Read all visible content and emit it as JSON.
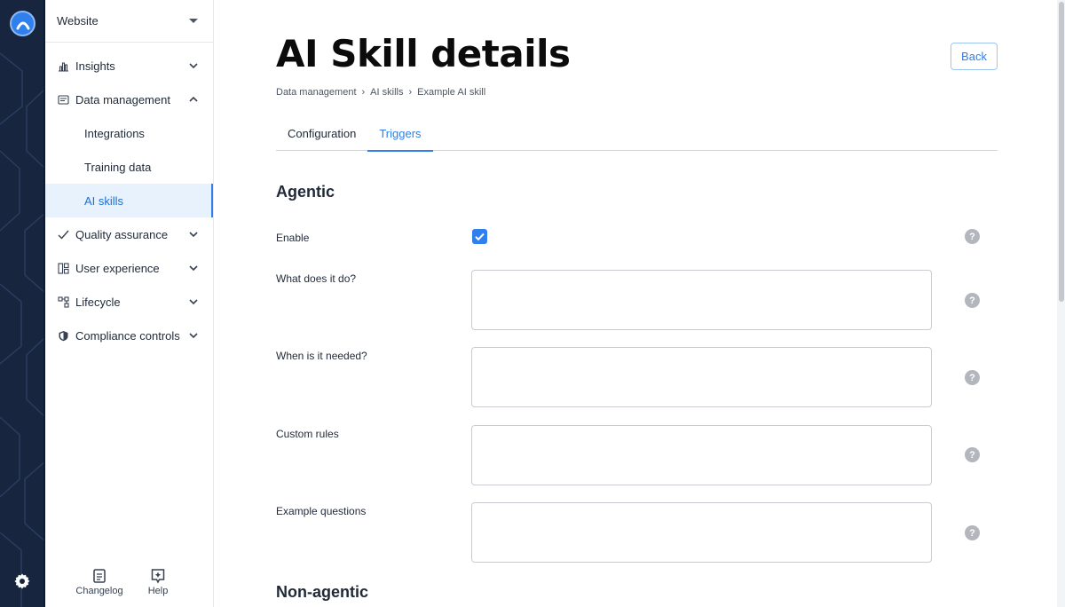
{
  "sidebar": {
    "workspace": "Website",
    "items": [
      {
        "label": "Insights",
        "icon": "bar-chart-icon",
        "expanded": false
      },
      {
        "label": "Data management",
        "icon": "database-icon",
        "expanded": true,
        "children": [
          {
            "label": "Integrations",
            "active": false
          },
          {
            "label": "Training data",
            "active": false
          },
          {
            "label": "AI skills",
            "active": true
          }
        ]
      },
      {
        "label": "Quality assurance",
        "icon": "check-icon",
        "expanded": false
      },
      {
        "label": "User experience",
        "icon": "layout-icon",
        "expanded": false
      },
      {
        "label": "Lifecycle",
        "icon": "flow-icon",
        "expanded": false
      },
      {
        "label": "Compliance controls",
        "icon": "shield-icon",
        "expanded": false
      }
    ],
    "footer": {
      "changelog": "Changelog",
      "help": "Help"
    }
  },
  "header": {
    "title": "AI Skill details",
    "back": "Back",
    "breadcrumb": [
      "Data management",
      "AI skills",
      "Example AI skill"
    ]
  },
  "tabs": [
    {
      "label": "Configuration",
      "active": false
    },
    {
      "label": "Triggers",
      "active": true
    }
  ],
  "agentic": {
    "heading": "Agentic",
    "enable_label": "Enable",
    "enable_checked": true,
    "fields": [
      {
        "label": "What does it do?",
        "value": ""
      },
      {
        "label": "When is it needed?",
        "value": ""
      },
      {
        "label": "Custom rules",
        "value": ""
      },
      {
        "label": "Example questions",
        "value": ""
      }
    ],
    "help_glyph": "?"
  },
  "non_agentic": {
    "heading": "Non-agentic"
  },
  "colors": {
    "accent": "#2f80ed",
    "rail": "#17253f",
    "active_bg": "#e8f2fd"
  }
}
